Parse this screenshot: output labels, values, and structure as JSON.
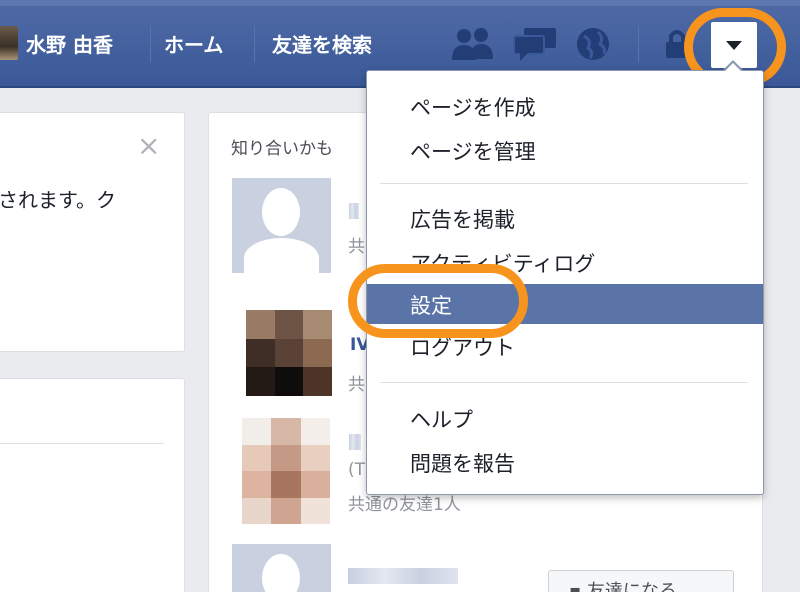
{
  "header": {
    "user_name": "水野 由香",
    "home_label": "ホーム",
    "find_friends_label": "友達を検索",
    "icons": [
      "friend-requests-icon",
      "messages-icon",
      "notifications-globe-icon",
      "privacy-lock-icon"
    ],
    "dropdown_icon": "caret-down-icon"
  },
  "notice": {
    "text": "されます。ク",
    "close_label": "×"
  },
  "pymk": {
    "title": "知り合いかも",
    "friends": [
      {
        "meta": "共"
      },
      {
        "name_fragment": "IV",
        "meta": "共"
      },
      {
        "name_fragment": "(T",
        "meta": "共通の友達1人"
      },
      {
        "add_button_label": "友達になる"
      }
    ]
  },
  "menu": {
    "items": [
      {
        "label": "ページを作成"
      },
      {
        "label": "ページを管理"
      },
      {
        "label": "広告を掲載"
      },
      {
        "label": "アクティビティログ"
      },
      {
        "label": "設定",
        "highlighted": true
      },
      {
        "label": "ログアウト"
      },
      {
        "label": "ヘルプ"
      },
      {
        "label": "問題を報告"
      }
    ]
  },
  "colors": {
    "brand_blue": "#3b5998",
    "highlight": "#5b74a8",
    "annotation_orange": "#f7941d"
  }
}
